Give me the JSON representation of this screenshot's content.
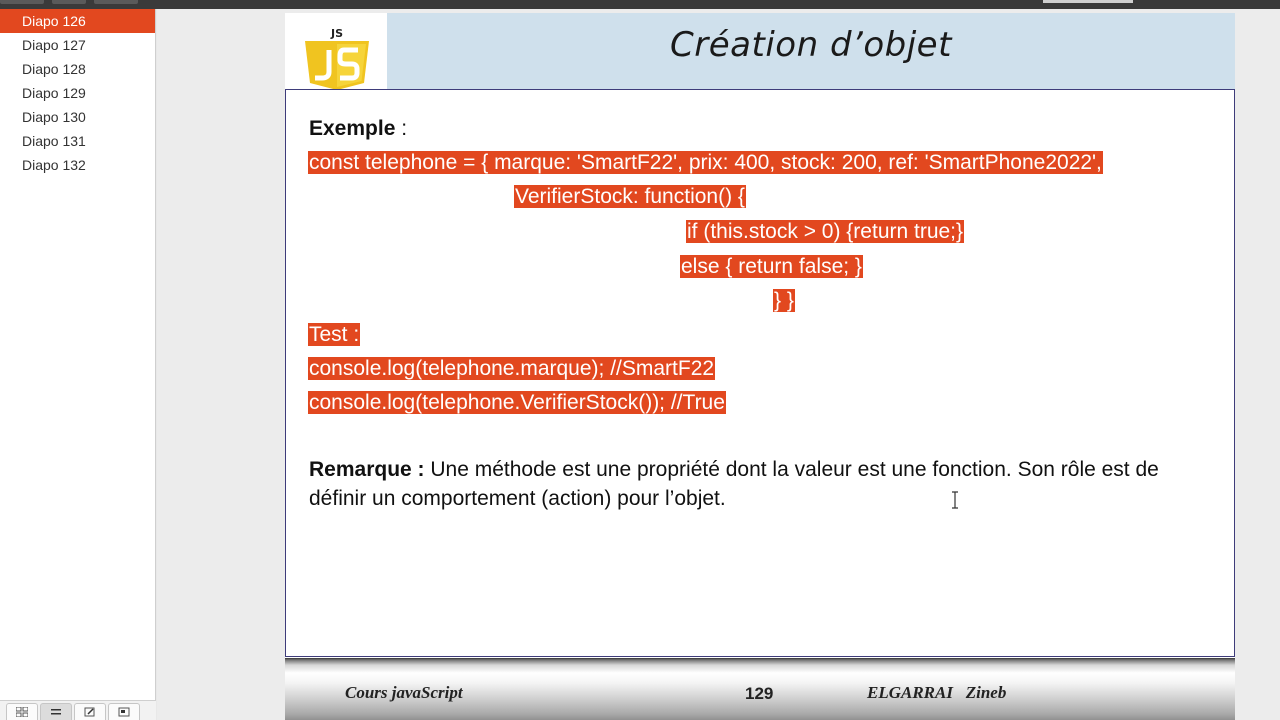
{
  "sidebar": {
    "items": [
      {
        "label": "Diapo 126",
        "active": true
      },
      {
        "label": "Diapo 127",
        "active": false
      },
      {
        "label": "Diapo 128",
        "active": false
      },
      {
        "label": "Diapo 129",
        "active": false
      },
      {
        "label": "Diapo 130",
        "active": false
      },
      {
        "label": "Diapo 131",
        "active": false
      },
      {
        "label": "Diapo 132",
        "active": false
      }
    ],
    "view_buttons": [
      "grid-view-icon",
      "outline-view-icon",
      "edit-view-icon",
      "notes-view-icon"
    ]
  },
  "slide": {
    "logo_text": "JS",
    "title": "Création d’objet",
    "example_label": "Exemple",
    "example_colon": " :",
    "code": {
      "line1": "const telephone = { marque: 'SmartF22', prix: 400, stock: 200, ref: 'SmartPhone2022',",
      "line2": "VerifierStock: function() {",
      "line3": "if (this.stock > 0) {return true;}",
      "line4": "else {  return false; }",
      "line5": "} }"
    },
    "test_label": "Test :",
    "test_lines": [
      "console.log(telephone.marque); //SmartF22",
      "console.log(telephone.VerifierStock()); //True"
    ],
    "remark_label": "Remarque :",
    "remark_text": "  Une méthode est une propriété dont la valeur est une fonction. Son rôle est de définir un comportement (action) pour l’objet.",
    "footer": {
      "course": "Cours javaScript",
      "page": "129",
      "author": "ELGARRAI   Zineb"
    }
  },
  "colors": {
    "highlight": "#e2481f",
    "header_bg": "#cfe0ec",
    "js_yellow": "#f0c420"
  }
}
